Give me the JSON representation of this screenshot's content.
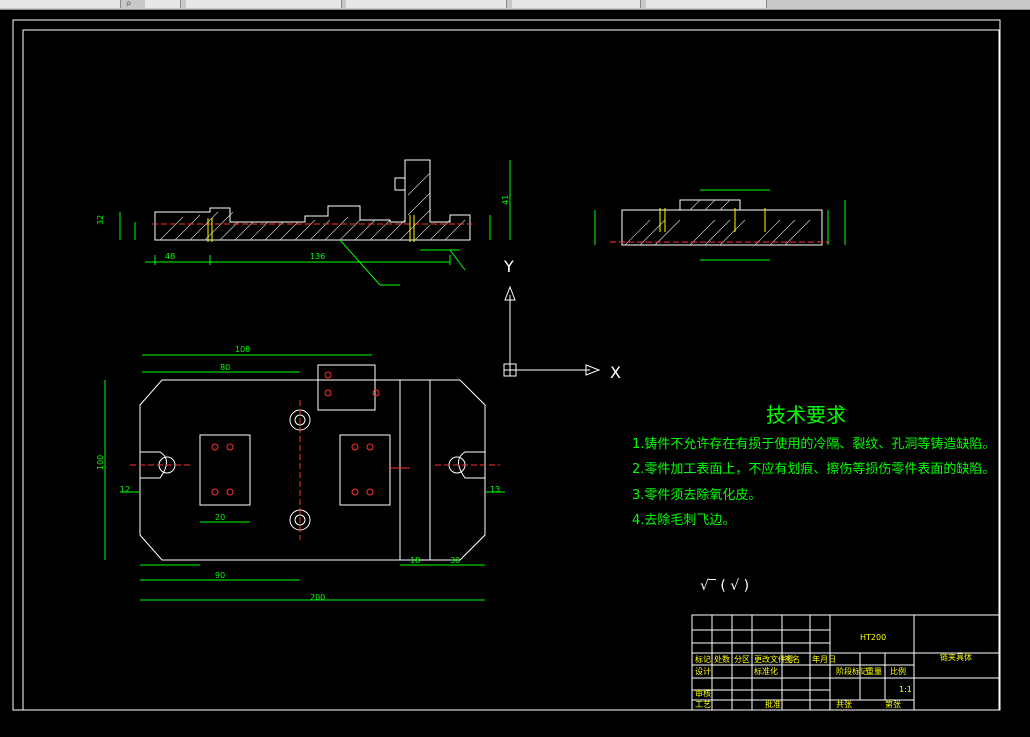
{
  "window": {
    "toolbar_items": [
      "",
      "",
      "",
      "",
      ""
    ]
  },
  "ucs": {
    "y_label": "Y",
    "x_label": "X"
  },
  "requirements": {
    "title": "技术要求",
    "items": [
      "1.铸件不允许存在有损于使用的冷隔、裂纹、孔洞等铸造缺陷。",
      "2.零件加工表面上，不应有划痕、擦伤等损伤零件表面的缺陷。",
      "3.零件须去除氧化皮。",
      "4.去除毛刺飞边。"
    ]
  },
  "roughness_note": "√‾ ( √ )",
  "dims_top": {
    "left_width": "48",
    "mid_width": "136",
    "height_left": "32",
    "height_right": "41"
  },
  "dims_plan": {
    "overall_width": "200",
    "overall_height": "100",
    "top_span": "108",
    "left_span": "80",
    "right_span": "30",
    "bottom_left": "90",
    "bottom_right": "18",
    "inner_width": "20",
    "offset_left": "12",
    "offset_right": "13"
  },
  "title_block": {
    "material": "HT200",
    "part_name": "链夹具体",
    "scale": "1:1",
    "label_weight": "重量",
    "label_scale": "比例",
    "label_sheet": "共张",
    "label_sheet_of": "第张",
    "label_designer": "设计",
    "label_reviewer": "审核",
    "label_process": "工艺",
    "label_standard": "标准化",
    "label_approve": "批准",
    "label_stage": "阶段标记",
    "label_date": "年月日",
    "label_mark": "标记",
    "label_count": "处数",
    "label_zone": "分区",
    "label_change": "更改文件号",
    "label_sign": "签名"
  },
  "colors": {
    "background": "#000000",
    "primary_lines": "#ffffff",
    "dimension_lines": "#00ff00",
    "accent_red": "#ff3333",
    "accent_yellow": "#ffff00",
    "accent_cyan": "#00ffff"
  }
}
